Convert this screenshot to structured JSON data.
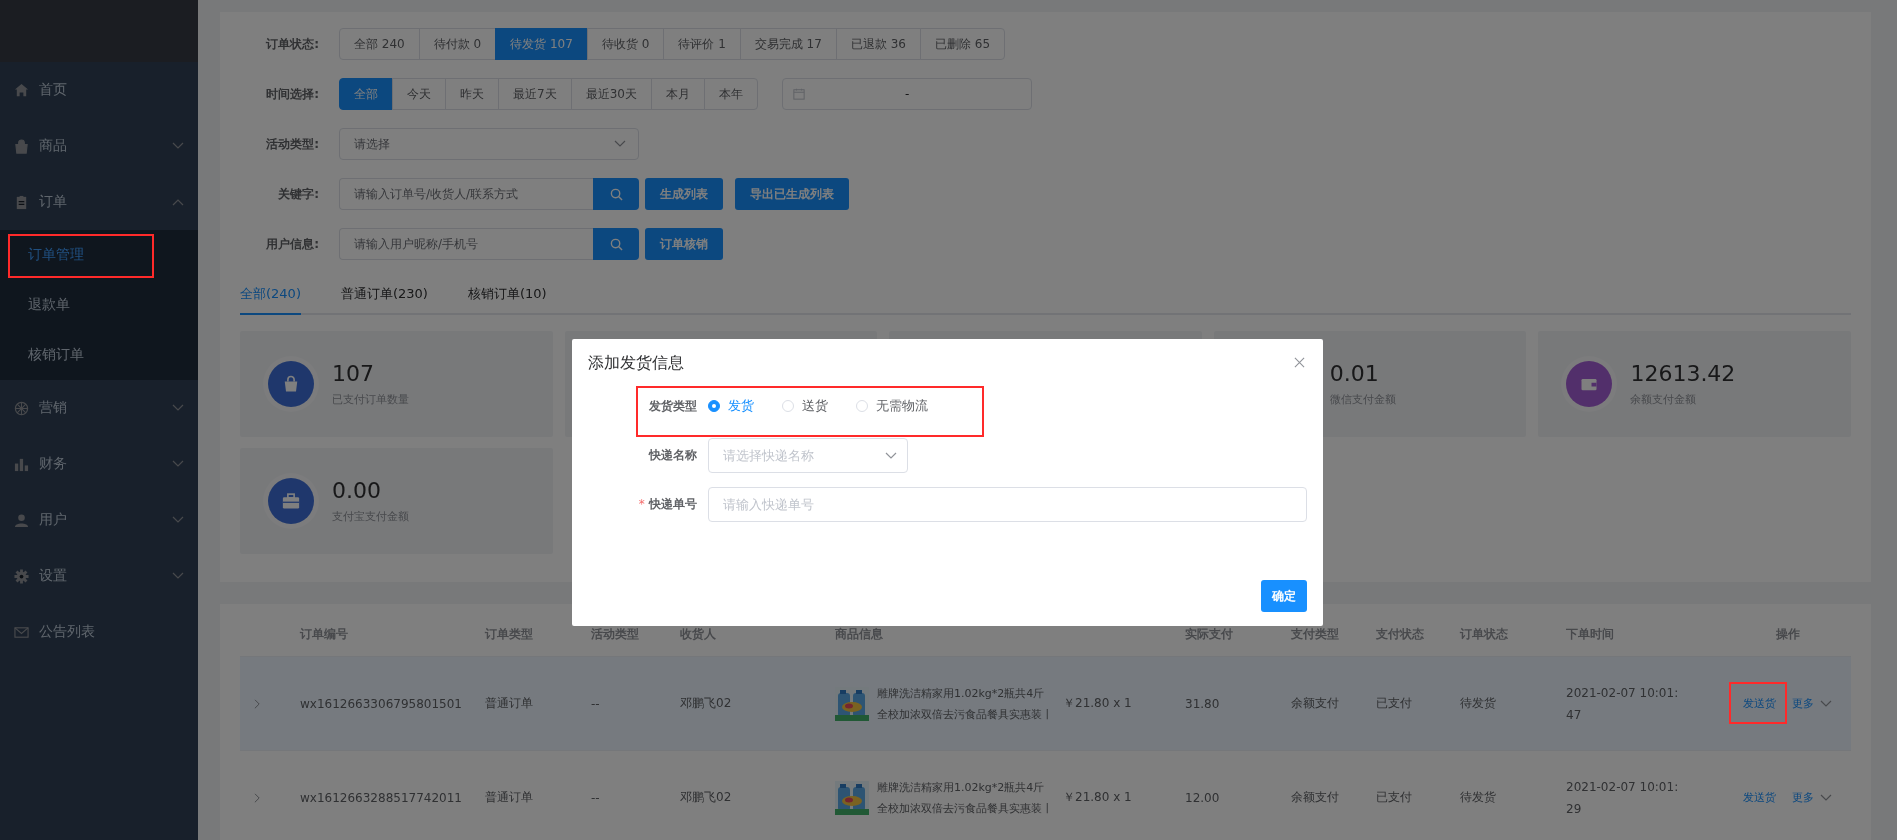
{
  "sidebar": {
    "items": [
      {
        "label": "首页"
      },
      {
        "label": "商品",
        "expandable": true,
        "expanded": false
      },
      {
        "label": "订单",
        "expandable": true,
        "expanded": true,
        "children": [
          {
            "label": "订单管理",
            "selected": true,
            "highlighted": true
          },
          {
            "label": "退款单",
            "selected": false,
            "highlighted": false
          },
          {
            "label": "核销订单",
            "selected": false,
            "highlighted": false
          }
        ]
      },
      {
        "label": "营销",
        "expandable": true,
        "expanded": false
      },
      {
        "label": "财务",
        "expandable": true,
        "expanded": false
      },
      {
        "label": "用户",
        "expandable": true,
        "expanded": false
      },
      {
        "label": "设置",
        "expandable": true,
        "expanded": false
      },
      {
        "label": "公告列表"
      }
    ]
  },
  "filters": {
    "status": {
      "label": "订单状态:",
      "options": [
        {
          "label": "全部 240",
          "selected": false
        },
        {
          "label": "待付款 0",
          "selected": false
        },
        {
          "label": "待发货 107",
          "selected": true
        },
        {
          "label": "待收货 0",
          "selected": false
        },
        {
          "label": "待评价 1",
          "selected": false
        },
        {
          "label": "交易完成 17",
          "selected": false
        },
        {
          "label": "已退款 36",
          "selected": false
        },
        {
          "label": "已删除 65",
          "selected": false
        }
      ]
    },
    "time": {
      "label": "时间选择:",
      "options": [
        {
          "label": "全部",
          "selected": true
        },
        {
          "label": "今天",
          "selected": false
        },
        {
          "label": "昨天",
          "selected": false
        },
        {
          "label": "最近7天",
          "selected": false
        },
        {
          "label": "最近30天",
          "selected": false
        },
        {
          "label": "本月",
          "selected": false
        },
        {
          "label": "本年",
          "selected": false
        }
      ],
      "range_separator": "-"
    },
    "activity": {
      "label": "活动类型:",
      "placeholder": "请选择"
    },
    "keyword": {
      "label": "关键字:",
      "placeholder": "请输入订单号/收货人/联系方式",
      "buttons": [
        "生成列表",
        "导出已生成列表"
      ]
    },
    "user": {
      "label": "用户信息:",
      "placeholder": "请输入用户昵称/手机号",
      "buttons": [
        "订单核销"
      ]
    }
  },
  "tabs": [
    {
      "label": "全部(240)",
      "selected": true
    },
    {
      "label": "普通订单(230)",
      "selected": false
    },
    {
      "label": "核销订单(10)",
      "selected": false
    }
  ],
  "stats": {
    "row_1": [
      {
        "value": "107",
        "label": "已支付订单数量"
      },
      {
        "value": "0.01",
        "label": "微信支付金额"
      },
      {
        "value": "12613.42",
        "label": "余额支付金额"
      }
    ],
    "row_2": [
      {
        "value": "0.00",
        "label": "支付宝支付金额"
      }
    ]
  },
  "table": {
    "columns": [
      "订单编号",
      "订单类型",
      "活动类型",
      "收货人",
      "商品信息",
      "实际支付",
      "支付类型",
      "支付状态",
      "订单状态",
      "下单时间",
      "操作"
    ],
    "rows": [
      {
        "hovered": true,
        "order_no": "wx1612663306795801501",
        "order_type": "普通订单",
        "activity": "--",
        "receiver": "邓鹏飞02",
        "product": "雕牌洗洁精家用1.02kg*2瓶共4斤全校加浓双倍去污食品餐具实惠装丨",
        "price": "￥21.80 x 1",
        "paid": "31.80",
        "pay_type": "余额支付",
        "pay_status": "已支付",
        "order_status": "待发货",
        "time": "2021-02-07 10:01:47",
        "action": "发送货",
        "more": "更多",
        "highlighted": true
      },
      {
        "hovered": false,
        "order_no": "wx1612663288517742011",
        "order_type": "普通订单",
        "activity": "--",
        "receiver": "邓鹏飞02",
        "product": "雕牌洗洁精家用1.02kg*2瓶共4斤全校加浓双倍去污食品餐具实惠装丨",
        "price": "￥21.80 x 1",
        "paid": "12.00",
        "pay_type": "余额支付",
        "pay_status": "已支付",
        "order_status": "待发货",
        "time": "2021-02-07 10:01:29",
        "action": "发送货",
        "more": "更多",
        "highlighted": false
      }
    ]
  },
  "dialog": {
    "title": "添加发货信息",
    "type_field": {
      "label": "发货类型",
      "highlighted": true,
      "options": [
        {
          "label": "发货",
          "selected": true
        },
        {
          "label": "送货",
          "selected": false
        },
        {
          "label": "无需物流",
          "selected": false
        }
      ]
    },
    "courier": {
      "label": "快递名称",
      "placeholder": "请选择快递名称"
    },
    "tracking": {
      "label": "快递单号",
      "required_mark": "*",
      "placeholder": "请输入快递单号"
    },
    "confirm": "确定"
  }
}
